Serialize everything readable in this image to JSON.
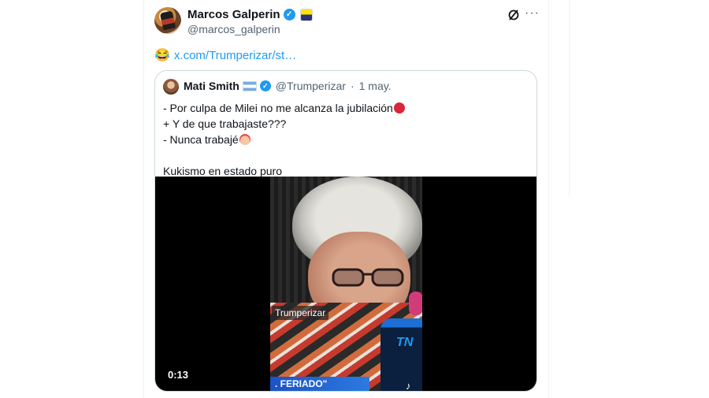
{
  "tweet": {
    "display_name": "Marcos Galperin",
    "handle": "@marcos_galperin",
    "text_emoji": "😂",
    "link": "x.com/Trumperizar/st…"
  },
  "quoted": {
    "display_name": "Mati Smith",
    "handle": "@Trumperizar",
    "separator": "·",
    "date": "1 may.",
    "lines": [
      "- Por culpa de Milei no me alcanza la jubilación",
      "+ Y de que trabajaste???",
      "- Nunca trabajé",
      "",
      "Kukismo en estado puro"
    ],
    "video": {
      "watermark": "Trumperizar",
      "banner": ". FERIADO\"",
      "mic_logo": "TN",
      "timestamp": "0:13"
    }
  },
  "icons": {
    "verified": "verified-badge-icon",
    "affiliate": "affiliate-badge-icon",
    "grok": "grok-icon",
    "more": "more-icon",
    "tiktok": "tiktok-icon"
  },
  "colors": {
    "link": "#1d9bf0",
    "secondary_text": "#536471",
    "border": "#cfd9de"
  }
}
